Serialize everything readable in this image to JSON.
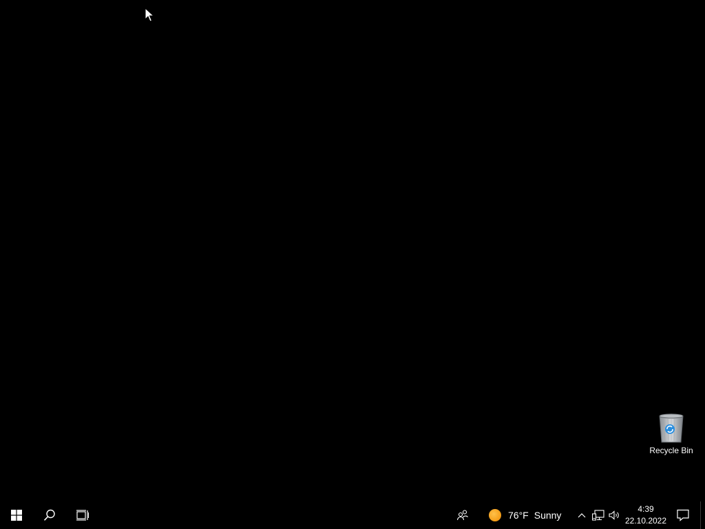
{
  "desktop": {
    "background_color": "#000000",
    "icons": [
      {
        "label": "Recycle Bin",
        "icon": "recycle-bin-icon"
      }
    ]
  },
  "taskbar": {
    "background_color": "#000000",
    "start": {
      "icon": "windows-logo-icon"
    },
    "search": {
      "icon": "search-icon"
    },
    "task_view": {
      "icon": "task-view-icon"
    },
    "people": {
      "icon": "people-icon"
    },
    "weather": {
      "icon": "sun-icon",
      "temperature": "76°F",
      "condition": "Sunny",
      "accent_color": "#f5a10a"
    },
    "tray": {
      "chevron_icon": "chevron-up-icon",
      "network_icon": "network-wired-icon",
      "volume_icon": "volume-icon"
    },
    "clock": {
      "time": "4:39",
      "date": "22.10.2022"
    },
    "action_center": {
      "icon": "notification-icon"
    }
  }
}
